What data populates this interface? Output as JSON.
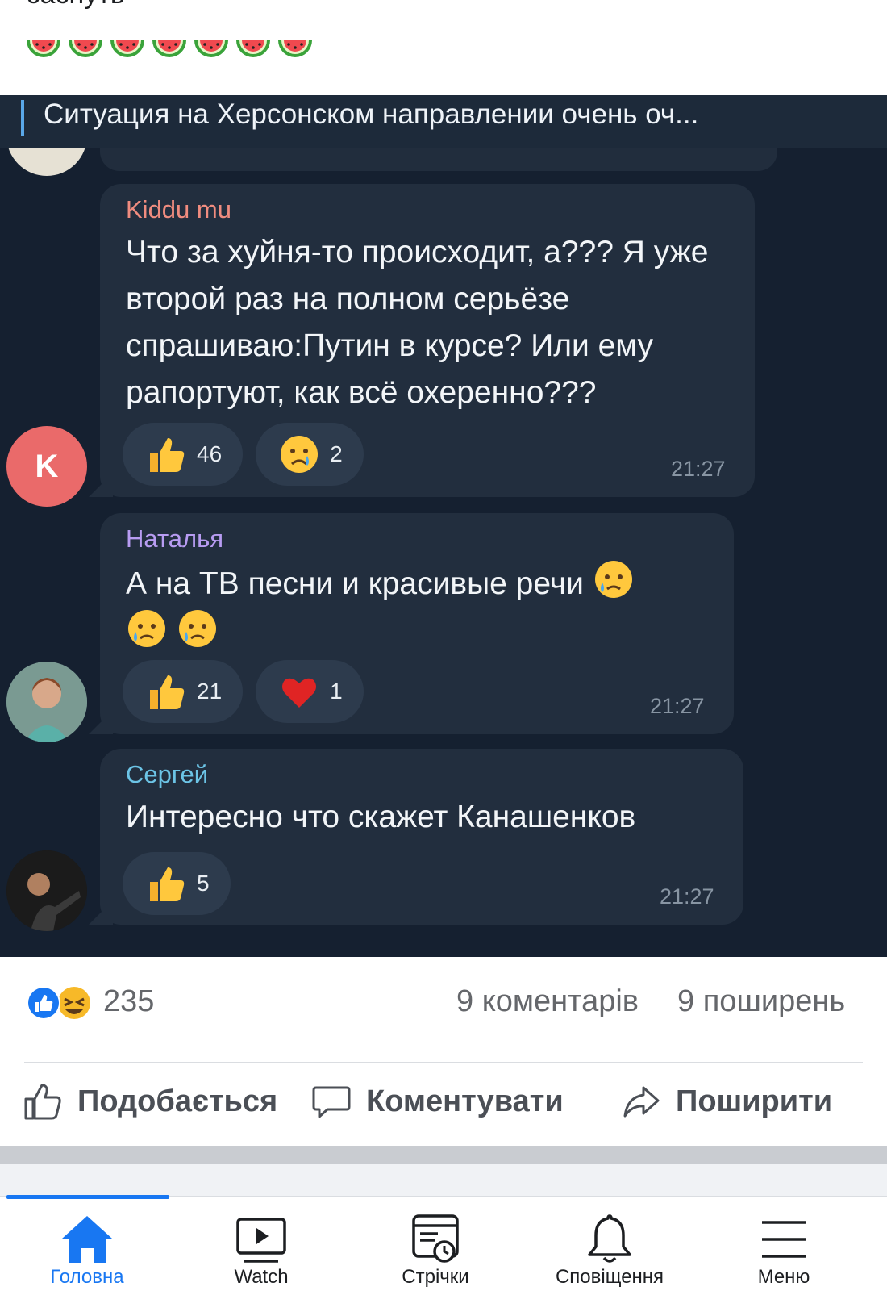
{
  "post": {
    "text_fragment": "заснуть",
    "watermelon_count": 7
  },
  "chat": {
    "pinned_text": "Ситуация на Херсонском направлении очень оч...",
    "messages": [
      {
        "author": "Kiddu mu",
        "author_color": "#f08c7f",
        "avatar_letter": "K",
        "text": "Что за хуйня-то происходит, а??? Я уже второй раз на полном серьёзе спрашиваю:Путин в курсе? Или ему рапортуют, как всё охеренно???",
        "reactions": [
          {
            "icon": "thumbs-up-icon",
            "count": "46"
          },
          {
            "icon": "crying-face-icon",
            "count": "2"
          }
        ],
        "time": "21:27"
      },
      {
        "author": "Наталья",
        "author_color": "#b89cf2",
        "text": "А на ТВ песни и красивые речи",
        "reactions": [
          {
            "icon": "thumbs-up-icon",
            "count": "21"
          },
          {
            "icon": "heart-icon",
            "count": "1"
          }
        ],
        "time": "21:27"
      },
      {
        "author": "Сергей",
        "author_color": "#6cc4e6",
        "text": "Интересно что скажет Канашенков",
        "reactions": [
          {
            "icon": "thumbs-up-icon",
            "count": "5"
          }
        ],
        "time": "21:27"
      }
    ]
  },
  "stats": {
    "reaction_count": "235",
    "comments": "9 коментарів",
    "shares": "9 поширень"
  },
  "actions": {
    "like": "Подобається",
    "comment": "Коментувати",
    "share": "Поширити"
  },
  "tabs": [
    {
      "label": "Головна",
      "icon": "home-icon",
      "active": true
    },
    {
      "label": "Watch",
      "icon": "video-icon",
      "active": false
    },
    {
      "label": "Стрічки",
      "icon": "feeds-icon",
      "active": false
    },
    {
      "label": "Сповіщення",
      "icon": "bell-icon",
      "active": false
    },
    {
      "label": "Меню",
      "icon": "menu-icon",
      "active": false
    }
  ],
  "colors": {
    "accent": "#1877f2",
    "chat_bg": "#152030",
    "bubble": "#222e3e"
  }
}
